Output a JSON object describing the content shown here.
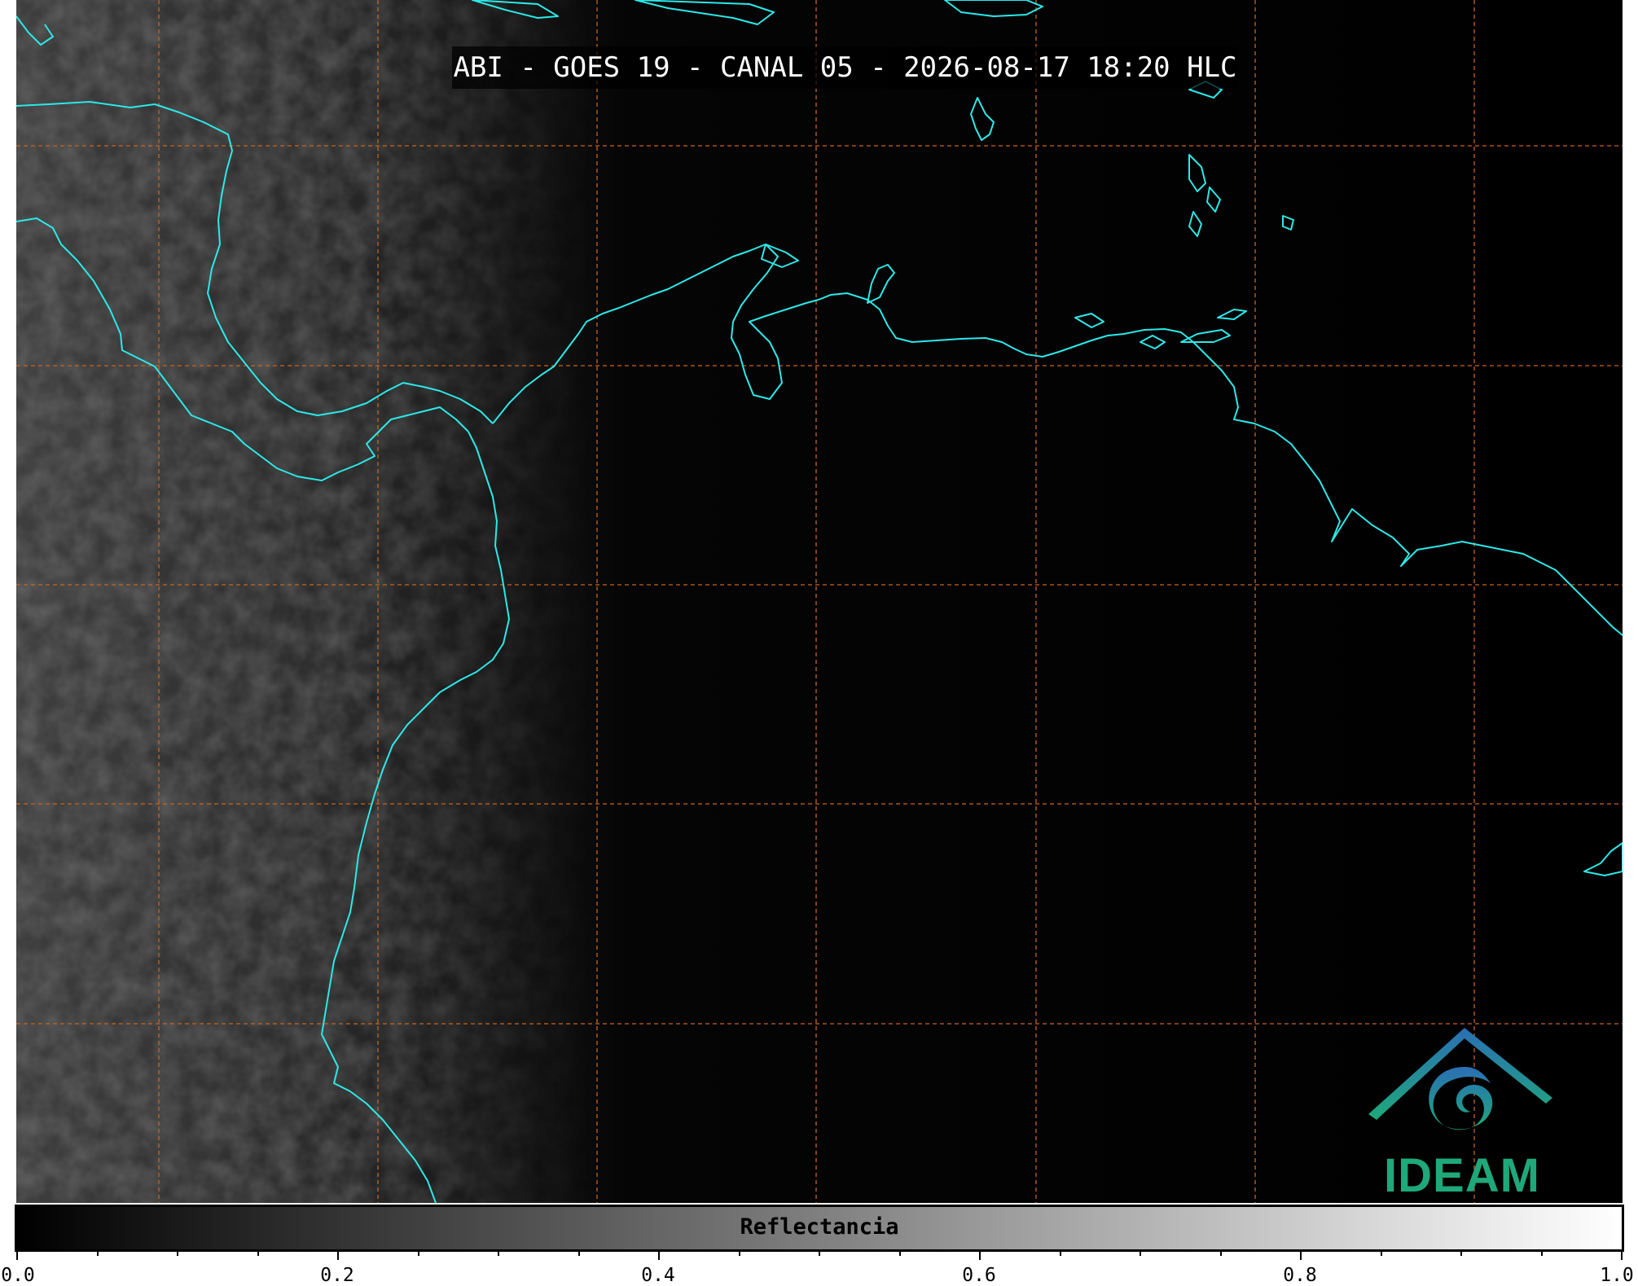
{
  "map": {
    "title": "ABI - GOES 19 - CANAL 05 - 2026-08-17 18:20 HLC",
    "overlay": "coastlines",
    "coastline_color": "#2de8e8",
    "gridline_color": "#c8641e",
    "background_color": "#000000"
  },
  "colorbar": {
    "label": "Reflectancia",
    "range": [
      0.0,
      1.0
    ],
    "colormap": "grayscale",
    "tick_labels": [
      "0.0",
      "0.2",
      "0.4",
      "0.6",
      "0.8",
      "1.0"
    ]
  },
  "logo": {
    "text": "IDEAM",
    "color_top": "#2a6fb5",
    "color_bottom": "#1fa87a"
  }
}
